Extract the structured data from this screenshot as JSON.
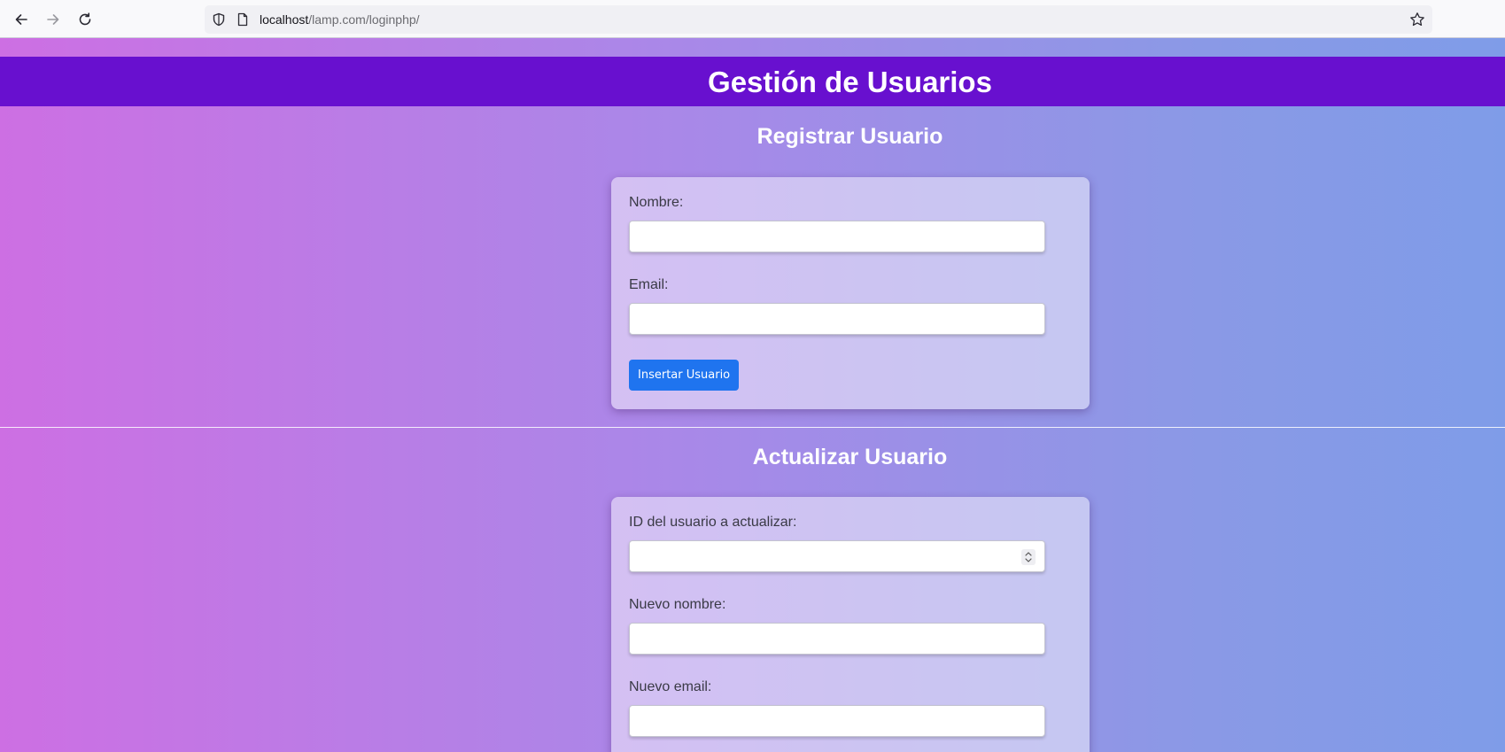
{
  "browser": {
    "url_host": "localhost",
    "url_path": "/lamp.com/loginphp/"
  },
  "page": {
    "title": "Gestión de Usuarios"
  },
  "register": {
    "heading": "Registrar Usuario",
    "name_label": "Nombre:",
    "name_value": "",
    "email_label": "Email:",
    "email_value": "",
    "submit_label": "Insertar Usuario"
  },
  "update": {
    "heading": "Actualizar Usuario",
    "id_label": "ID del usuario a actualizar:",
    "id_value": "",
    "new_name_label": "Nuevo nombre:",
    "new_name_value": "",
    "new_email_label": "Nuevo email:",
    "new_email_value": ""
  }
}
